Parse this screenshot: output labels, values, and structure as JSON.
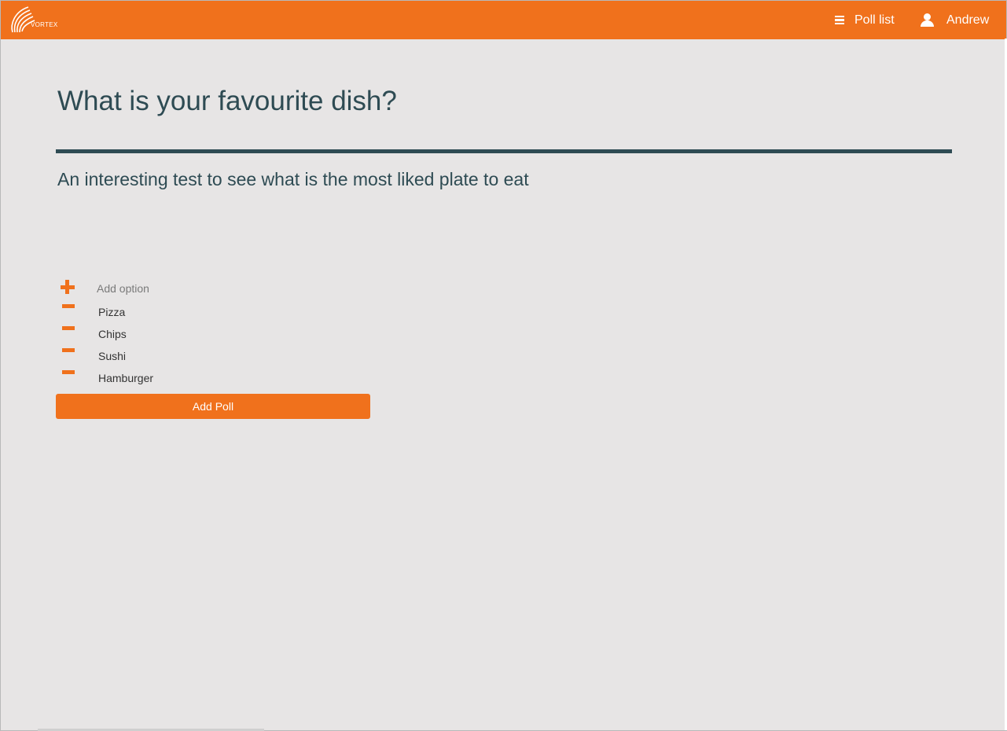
{
  "brand": {
    "logo_text": "VORTEX"
  },
  "colors": {
    "accent": "#f0711c",
    "heading": "#2e4b53",
    "background": "#e7e5e5"
  },
  "nav": {
    "poll_list_label": "Poll list",
    "poll_list_icon": "menu-icon",
    "user_label": "Andrew",
    "user_icon": "user-icon"
  },
  "poll": {
    "title": "What is your favourite dish?",
    "description": "An interesting test to see what is the most liked plate to eat",
    "add_option_placeholder": "Add option",
    "add_option_value": "",
    "options": [
      {
        "label": "Pizza"
      },
      {
        "label": "Chips"
      },
      {
        "label": "Sushi"
      },
      {
        "label": "Hamburger"
      }
    ],
    "submit_label": "Add Poll"
  }
}
